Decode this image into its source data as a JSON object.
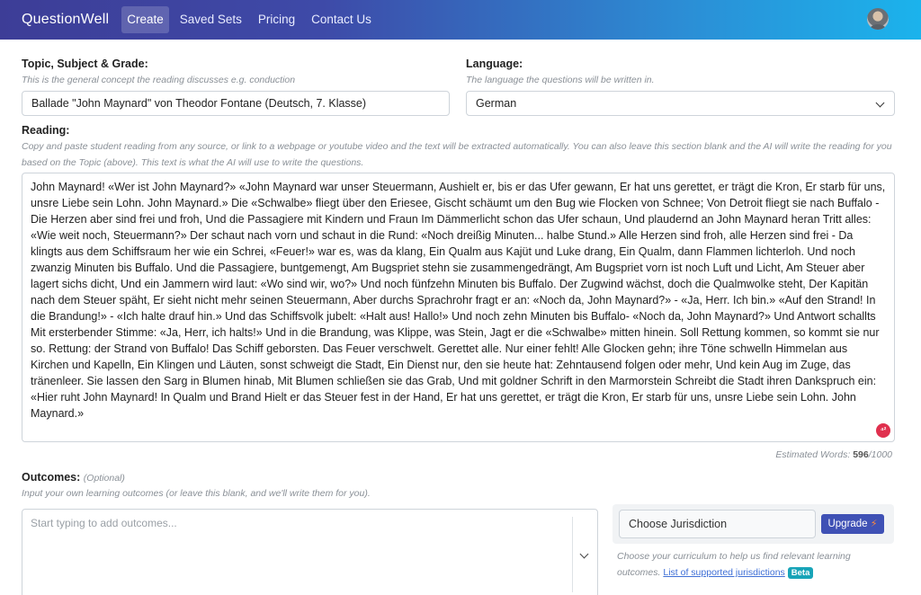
{
  "header": {
    "brand": "QuestionWell",
    "nav": [
      "Create",
      "Saved Sets",
      "Pricing",
      "Contact Us"
    ]
  },
  "topic": {
    "label": "Topic, Subject & Grade:",
    "hint": "This is the general concept the reading discusses e.g. conduction",
    "value": "Ballade \"John Maynard\" von Theodor Fontane (Deutsch, 7. Klasse)"
  },
  "language": {
    "label": "Language:",
    "hint": "The language the questions will be written in.",
    "value": "German"
  },
  "reading": {
    "label": "Reading:",
    "hint": "Copy and paste student reading from any source, or link to a webpage or youtube video and the text will be extracted automatically. You can also leave this section blank and the AI will write the reading for you based on the Topic (above). This text is what the AI will use to write the questions.",
    "text": "John Maynard! «Wer ist John Maynard?» «John Maynard war unser Steuermann, Aushielt er, bis er das Ufer gewann, Er hat uns gerettet, er trägt die Kron, Er starb für uns, unsre Liebe sein Lohn. John Maynard.» Die «Schwalbe» fliegt über den Eriesee, Gischt schäumt um den Bug wie Flocken von Schnee; Von Detroit fliegt sie nach Buffalo - Die Herzen aber sind frei und froh, Und die Passagiere mit Kindern und Fraun Im Dämmerlicht schon das Ufer schaun, Und plaudernd an John Maynard heran Tritt alles: «Wie weit noch, Steuermann?» Der schaut nach vorn und schaut in die Rund: «Noch dreißig Minuten... halbe Stund.» Alle Herzen sind froh, alle Herzen sind frei - Da klingts aus dem Schiffsraum her wie ein Schrei, «Feuer!» war es, was da klang, Ein Qualm aus Kajüt und Luke drang, Ein Qualm, dann Flammen lichterloh. Und noch zwanzig Minuten bis Buffalo. Und die Passagiere, buntgemengt, Am Bugspriet stehn sie zusammengedrängt, Am Bugspriet vorn ist noch Luft und Licht, Am Steuer aber lagert sichs dicht, Und ein Jammern wird laut: «Wo sind wir, wo?» Und noch fünfzehn Minuten bis Buffalo. Der Zugwind wächst, doch die Qualmwolke steht, Der Kapitän nach dem Steuer späht, Er sieht nicht mehr seinen Steuermann, Aber durchs Sprachrohr fragt er an: «Noch da, John Maynard?» - «Ja, Herr. Ich bin.» «Auf den Strand! In die Brandung!» - «Ich halte drauf hin.» Und das Schiffsvolk jubelt: «Halt aus! Hallo!» Und noch zehn Minuten bis Buffalo- «Noch da, John Maynard?» Und Antwort schallts Mit ersterbender Stimme: «Ja, Herr, ich halts!» Und in die Brandung, was Klippe, was Stein, Jagt er die «Schwalbe» mitten hinein. Soll Rettung kommen, so kommt sie nur so. Rettung: der Strand von Buffalo! Das Schiff geborsten. Das Feuer verschwelt. Gerettet alle. Nur einer fehlt! Alle Glocken gehn; ihre Töne schwelln Himmelan aus Kirchen und Kapelln, Ein Klingen und Läuten, sonst schweigt die Stadt, Ein Dienst nur, den sie heute hat: Zehntausend folgen oder mehr, Und kein Aug im Zuge, das tränenleer. Sie lassen den Sarg in Blumen hinab, Mit Blumen schließen sie das Grab, Und mit goldner Schrift in den Marmorstein Schreibt die Stadt ihren Dankspruch ein: «Hier ruht John Maynard! In Qualm und Brand Hielt er das Steuer fest in der Hand, Er hat uns gerettet, er trägt die Kron, Er starb für uns, unsre Liebe sein Lohn. John Maynard.»",
    "grammarly_badge": "⁴²",
    "estimated_label": "Estimated Words:",
    "estimated_count": "596",
    "estimated_max": "/1000"
  },
  "outcomes": {
    "label": "Outcomes:",
    "optional": "(Optional)",
    "hint": "Input your own learning outcomes (or leave this blank, and we'll write them for you).",
    "placeholder": "Start typing to add outcomes..."
  },
  "jurisdiction": {
    "select_label": "Choose Jurisdiction",
    "upgrade_label": "Upgrade",
    "hint_prefix": "Choose your curriculum to help us find relevant learning outcomes.",
    "link": "List of supported jurisdictions",
    "beta": "Beta"
  },
  "colors": {
    "header_start": "#3d3d97",
    "header_end": "#1bb3ec",
    "upgrade": "#3f51b5",
    "beta": "#18a4b8"
  }
}
